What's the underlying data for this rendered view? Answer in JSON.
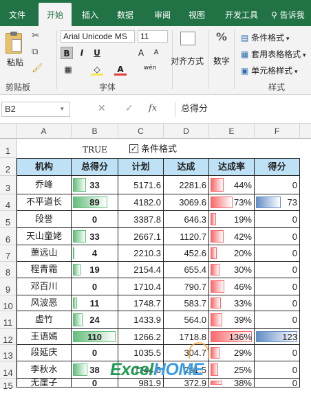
{
  "tabs": [
    "文件",
    "开始",
    "插入",
    "数据",
    "审阅",
    "视图",
    "开发工具"
  ],
  "active_tab": "开始",
  "tell_me": "告诉我",
  "ribbon": {
    "paste": "粘贴",
    "clipboard": "剪贴板",
    "font_name": "Arial Unicode MS",
    "font_size": "11",
    "bold": "B",
    "italic": "I",
    "underline": "U",
    "font_group": "字体",
    "align": "对齐方式",
    "number": "数字",
    "cond_format": "条件格式",
    "table_format": "套用表格格式",
    "cell_style": "单元格样式",
    "style_group": "样式"
  },
  "formula_bar": {
    "name_box": "B2",
    "content": "总得分"
  },
  "columns": [
    "A",
    "B",
    "C",
    "D",
    "E",
    "F"
  ],
  "row_numbers": [
    "1",
    "2",
    "3",
    "4",
    "5",
    "6",
    "7",
    "8",
    "9",
    "10",
    "11",
    "12",
    "13",
    "14",
    "15"
  ],
  "row1": {
    "true_text": "TRUE",
    "checkbox_label": "条件格式",
    "checked": true
  },
  "table": {
    "headers": [
      "机构",
      "总得分",
      "计划",
      "达成",
      "达成率",
      "得分"
    ],
    "rows": [
      {
        "name": "乔峰",
        "score": "33",
        "plan": "5171.6",
        "done": "2281.6",
        "rate": "44%",
        "pts": "0",
        "score_v": 33,
        "rate_v": 44,
        "pts_v": 0
      },
      {
        "name": "不平道长",
        "score": "89",
        "plan": "4182.0",
        "done": "3069.6",
        "rate": "73%",
        "pts": "73",
        "score_v": 89,
        "rate_v": 73,
        "pts_v": 73
      },
      {
        "name": "段誉",
        "score": "0",
        "plan": "3387.8",
        "done": "646.3",
        "rate": "19%",
        "pts": "0",
        "score_v": 0,
        "rate_v": 19,
        "pts_v": 0
      },
      {
        "name": "天山童姥",
        "score": "33",
        "plan": "2667.1",
        "done": "1120.7",
        "rate": "42%",
        "pts": "0",
        "score_v": 33,
        "rate_v": 42,
        "pts_v": 0
      },
      {
        "name": "萧远山",
        "score": "4",
        "plan": "2210.3",
        "done": "452.6",
        "rate": "20%",
        "pts": "0",
        "score_v": 4,
        "rate_v": 20,
        "pts_v": 0
      },
      {
        "name": "程青霜",
        "score": "19",
        "plan": "2154.4",
        "done": "655.4",
        "rate": "30%",
        "pts": "0",
        "score_v": 19,
        "rate_v": 30,
        "pts_v": 0
      },
      {
        "name": "邓百川",
        "score": "0",
        "plan": "1710.4",
        "done": "790.7",
        "rate": "46%",
        "pts": "0",
        "score_v": 0,
        "rate_v": 46,
        "pts_v": 0
      },
      {
        "name": "风波恶",
        "score": "11",
        "plan": "1748.7",
        "done": "583.7",
        "rate": "33%",
        "pts": "0",
        "score_v": 11,
        "rate_v": 33,
        "pts_v": 0
      },
      {
        "name": "虚竹",
        "score": "24",
        "plan": "1433.9",
        "done": "564.0",
        "rate": "39%",
        "pts": "0",
        "score_v": 24,
        "rate_v": 39,
        "pts_v": 0
      },
      {
        "name": "王语嫣",
        "score": "110",
        "plan": "1266.2",
        "done": "1718.8",
        "rate": "136%",
        "pts": "123",
        "score_v": 110,
        "rate_v": 136,
        "pts_v": 123
      },
      {
        "name": "段延庆",
        "score": "0",
        "plan": "1035.5",
        "done": "304.7",
        "rate": "29%",
        "pts": "0",
        "score_v": 0,
        "rate_v": 29,
        "pts_v": 0
      },
      {
        "name": "李秋水",
        "score": "38",
        "plan": "1144.6",
        "done": "291.5",
        "rate": "25%",
        "pts": "0",
        "score_v": 38,
        "rate_v": 25,
        "pts_v": 0
      },
      {
        "name": "无崖子",
        "score": "0",
        "plan": "981.9",
        "done": "372.9",
        "rate": "38%",
        "pts": "0",
        "score_v": 0,
        "rate_v": 38,
        "pts_v": 0
      }
    ]
  },
  "watermark": "ExcelHOME",
  "colors": {
    "ribbon_green": "#217346",
    "header_fill": "#bfe1f5",
    "green_bar": "#63be7b",
    "red_bar": "#f8696b",
    "blue_bar": "#638ec6"
  },
  "icons": [
    "cut-icon",
    "copy-icon",
    "format-painter-icon",
    "search-icon",
    "cancel-icon",
    "enter-icon",
    "fx-icon",
    "checkbox-icon"
  ]
}
